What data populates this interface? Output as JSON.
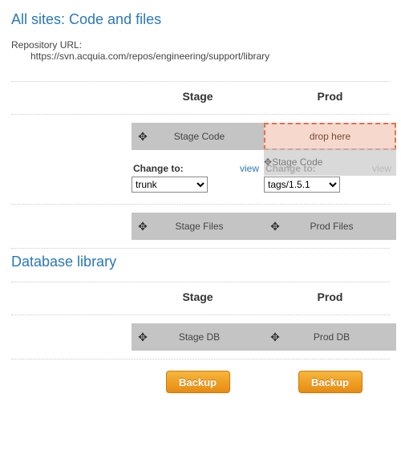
{
  "section1": {
    "title": "All sites: Code and files",
    "repo_label": "Repository URL:",
    "repo_url": "https://svn.acquia.com/repos/engineering/support/library",
    "columns": {
      "stage": "Stage",
      "prod": "Prod"
    },
    "code_row": {
      "stage_block": "Stage Code",
      "prod_drop_text": "drop here",
      "prod_ghost_block": "Stage Code"
    },
    "change_row": {
      "stage": {
        "label": "Change to:",
        "view": "view",
        "selected": "trunk"
      },
      "prod": {
        "label": "Change to:",
        "view": "view",
        "selected": "tags/1.5.1"
      }
    },
    "files_row": {
      "stage_block": "Stage Files",
      "prod_block": "Prod Files"
    }
  },
  "section2": {
    "title": "Database library",
    "columns": {
      "stage": "Stage",
      "prod": "Prod"
    },
    "db_row": {
      "stage_block": "Stage DB",
      "prod_block": "Prod DB"
    },
    "backup": {
      "stage": "Backup",
      "prod": "Backup"
    }
  },
  "icons": {
    "move": "✥"
  }
}
